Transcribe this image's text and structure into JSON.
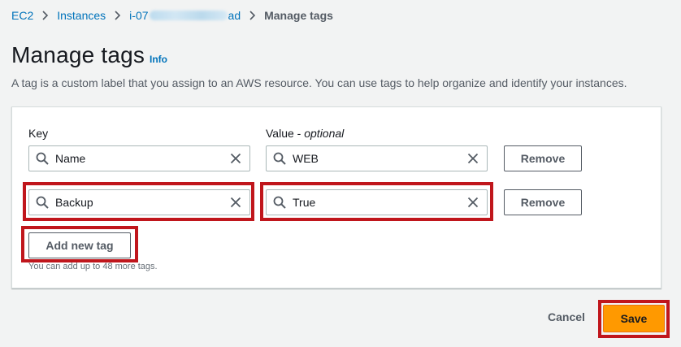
{
  "breadcrumb": {
    "items": [
      "EC2",
      "Instances"
    ],
    "instance_prefix": "i-07",
    "instance_suffix": "ad",
    "current": "Manage tags"
  },
  "header": {
    "title": "Manage tags",
    "info": "Info",
    "description": "A tag is a custom label that you assign to an AWS resource. You can use tags to help organize and identify your instances."
  },
  "tags": {
    "key_label": "Key",
    "value_label": "Value",
    "value_optional": "optional",
    "rows": [
      {
        "key": "Name",
        "value": "WEB",
        "remove_label": "Remove"
      },
      {
        "key": "Backup",
        "value": "True",
        "remove_label": "Remove"
      }
    ],
    "add_label": "Add new tag",
    "helper": "You can add up to 48 more tags."
  },
  "footer": {
    "cancel_label": "Cancel",
    "save_label": "Save"
  },
  "colors": {
    "link": "#0073bb",
    "primary": "#ff9900",
    "highlight": "#c0161c"
  }
}
